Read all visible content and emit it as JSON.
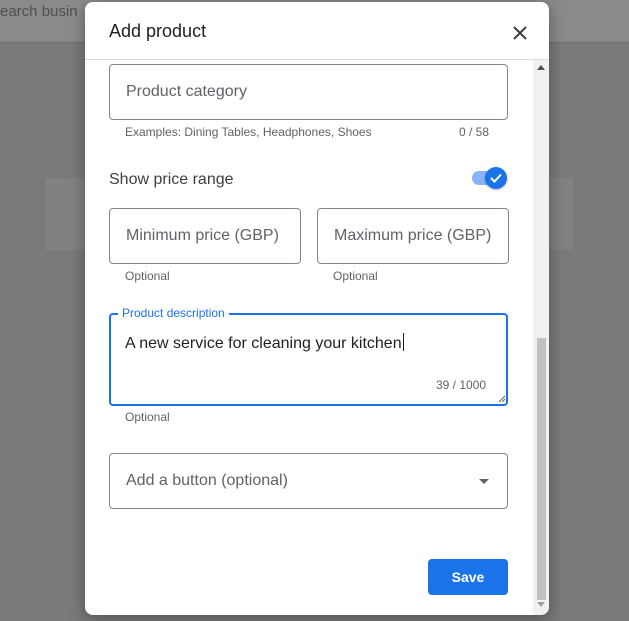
{
  "background": {
    "search_text": "earch busin"
  },
  "dialog": {
    "title": "Add product",
    "close_icon": "close-icon",
    "category": {
      "placeholder": "Product category",
      "helper": "Examples: Dining Tables, Headphones, Shoes",
      "counter": "0 / 58"
    },
    "price_range": {
      "label": "Show price range",
      "toggle_on": true,
      "min_placeholder": "Minimum price (GBP)",
      "min_helper": "Optional",
      "max_placeholder": "Maximum price (GBP)",
      "max_helper": "Optional"
    },
    "description": {
      "label": "Product description",
      "value": "A new service for cleaning your kitchen",
      "counter": "39 / 1000",
      "helper": "Optional"
    },
    "button_select": {
      "placeholder": "Add a button (optional)",
      "icon": "dropdown-arrow-icon"
    },
    "save_label": "Save"
  },
  "colors": {
    "accent": "#1a73e8",
    "toggle_track": "#8ab4f8"
  }
}
